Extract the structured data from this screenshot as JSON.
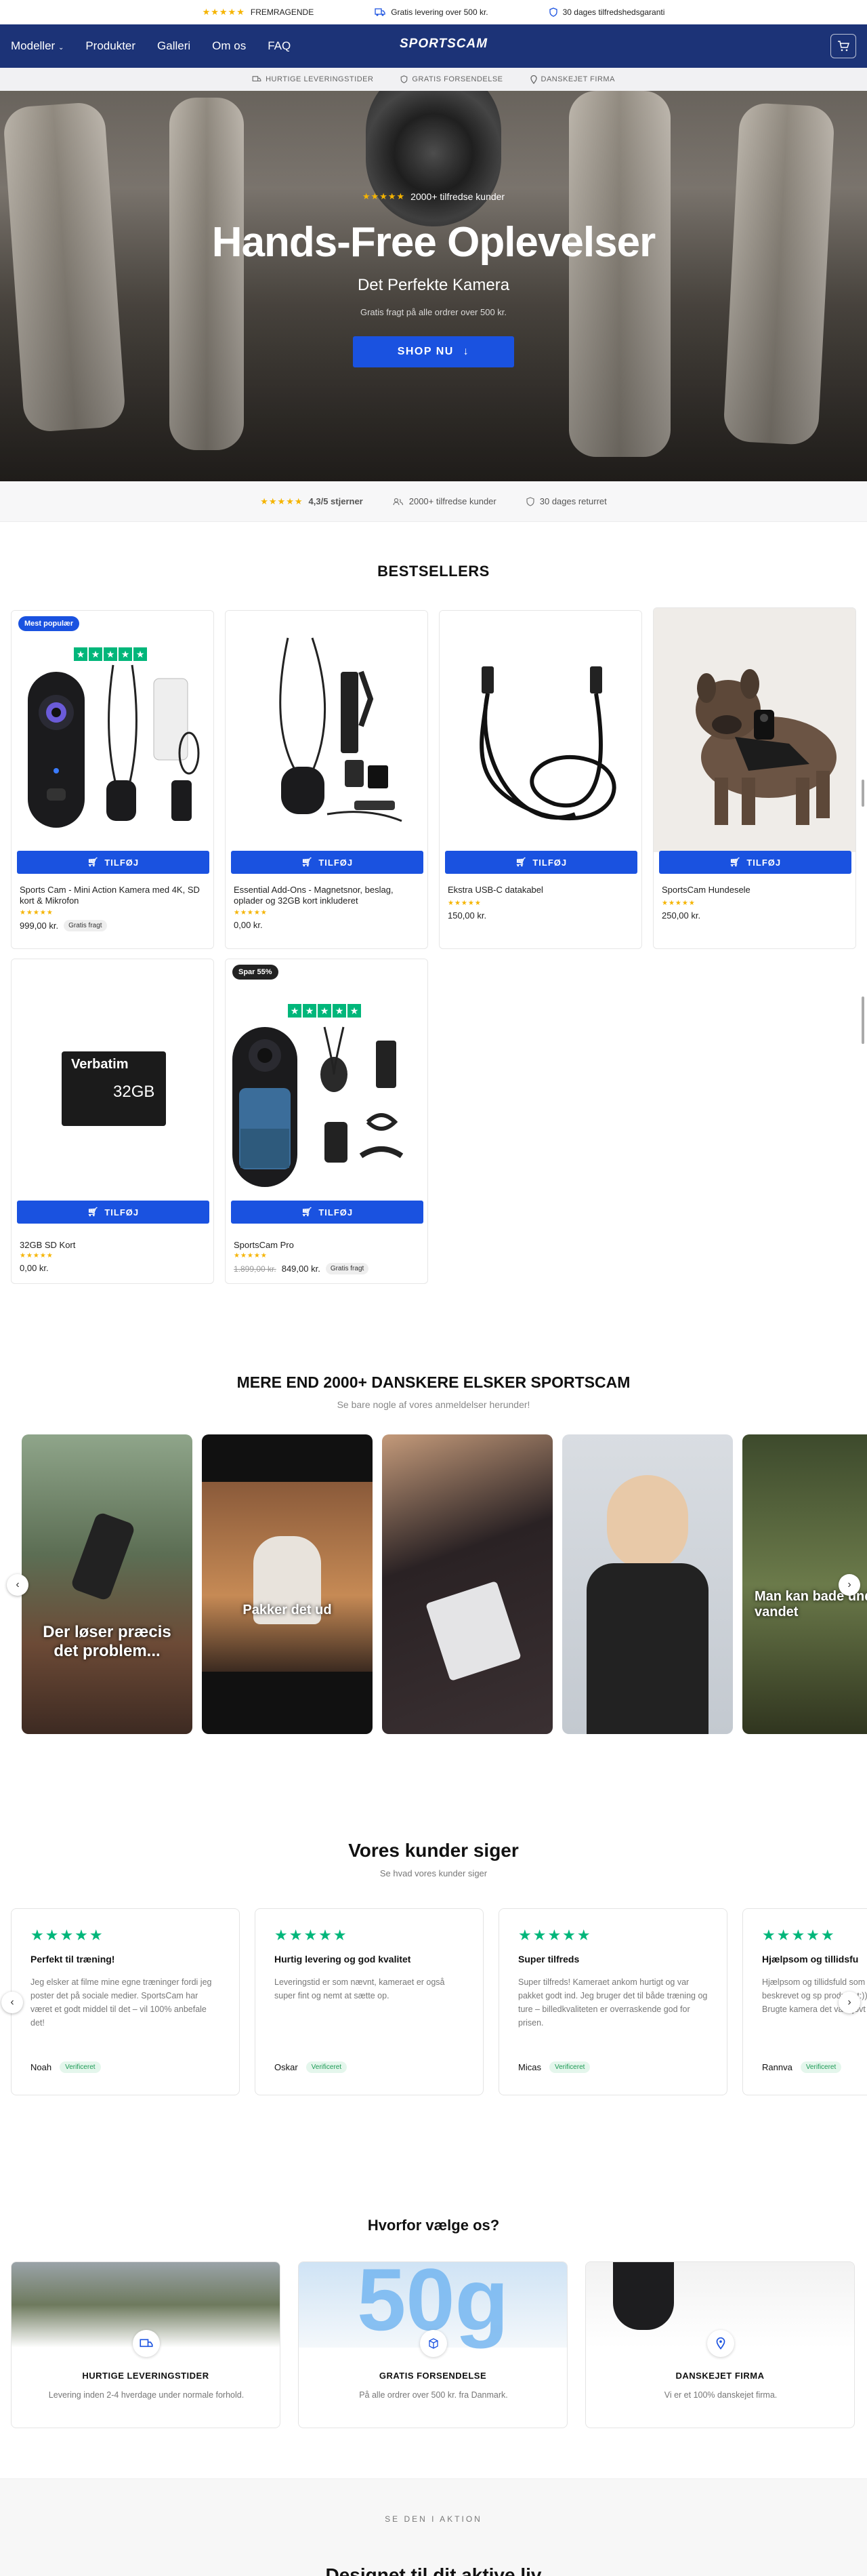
{
  "topbar": {
    "items": [
      {
        "stars": "★★★★★",
        "label": "FREMRAGENDE"
      },
      {
        "icon": "truck-icon",
        "label": "Gratis levering over 500 kr."
      },
      {
        "icon": "shield-icon",
        "label": "30 dages tilfredshedsgaranti"
      }
    ]
  },
  "nav": {
    "links": [
      "Modeller",
      "Produkter",
      "Galleri",
      "Om os",
      "FAQ"
    ],
    "logo": "SPORTSCAM"
  },
  "subbar": {
    "items": [
      "HURTIGE LEVERINGSTIDER",
      "GRATIS FORSENDELSE",
      "DANSKEJET FIRMA"
    ]
  },
  "hero": {
    "stars": "★★★★★",
    "rating_text": "2000+ tilfredse kunder",
    "title": "Hands-Free Oplevelser",
    "subtitle": "Det Perfekte Kamera",
    "small": "Gratis fragt på alle ordrer over 500 kr.",
    "cta": "SHOP NU"
  },
  "trust": {
    "stars": "★★★★★",
    "rating": "4,3/5 stjerner",
    "customers": "2000+ tilfredse kunder",
    "returns": "30 dages returret"
  },
  "bestsellers": {
    "heading": "BESTSELLERS",
    "add_label": "TILFØJ",
    "free_label": "Gratis fragt",
    "products": [
      {
        "badge": "Mest populær",
        "title": "Sports Cam - Mini Action Kamera med 4K, SD kort & Mikrofon",
        "stars": "★★★★★",
        "price": "999,00 kr.",
        "free": true
      },
      {
        "badge": "",
        "title": "Essential Add-Ons - Magnetsnor, beslag, oplader og 32GB kort inkluderet",
        "stars": "★★★★★",
        "price": "0,00 kr.",
        "free": false
      },
      {
        "badge": "",
        "title": "Ekstra USB-C datakabel",
        "stars": "★★★★★",
        "price": "150,00 kr.",
        "free": false
      },
      {
        "badge": "",
        "title": "SportsCam Hundesele",
        "stars": "★★★★★",
        "price": "250,00 kr.",
        "free": false
      },
      {
        "badge": "",
        "title": "32GB SD Kort",
        "stars": "★★★★★",
        "price": "0,00 kr.",
        "free": false
      },
      {
        "badge": "Spar 55%",
        "title": "SportsCam Pro",
        "stars": "★★★★★",
        "old_price": "1.899,00 kr.",
        "price": "849,00 kr.",
        "free": true
      }
    ],
    "sd_brand": "Verbatim",
    "sd_size": "32GB"
  },
  "ugc": {
    "heading": "MERE END 2000+ DANSKERE ELSKER SPORTSCAM",
    "sub": "Se bare nogle af vores anmeldelser herunder!",
    "captions": [
      "Der løser præcis det problem...",
      "Pakker det ud",
      "",
      "",
      "Man kan bade under vandet"
    ]
  },
  "reviews": {
    "heading": "Vores kunder siger",
    "sub": "Se hvad vores kunder siger",
    "verified": "Verificeret",
    "items": [
      {
        "title": "Perfekt til træning!",
        "body": "Jeg elsker at filme mine egne træninger fordi jeg poster det på sociale medier. SportsCam har været et godt middel til det – vil 100% anbefale det!",
        "name": "Noah"
      },
      {
        "title": "Hurtig levering og god kvalitet",
        "body": "Leveringstid er som nævnt, kameraet er også super fint og nemt at sætte op.",
        "name": "Oskar"
      },
      {
        "title": "Super tilfreds",
        "body": "Super tilfreds! Kameraet ankom hurtigt og var pakket godt ind. Jeg bruger det til både træning og ture – billedkvaliteten er overraskende god for prisen.",
        "name": "Micas"
      },
      {
        "title": "Hjælpsom og tillidsfu",
        "body": "Hjælpsom og tillidsfuld som beskrevet og sp produktet:)) Brugte kamera det var sjovt a",
        "name": "Rannva"
      }
    ]
  },
  "why": {
    "heading": "Hvorfor vælge os?",
    "items": [
      {
        "icon": "truck-icon",
        "title": "HURTIGE LEVERINGSTIDER",
        "desc": "Levering inden 2-4 hverdage under normale forhold."
      },
      {
        "icon": "box-icon",
        "title": "GRATIS FORSENDELSE",
        "desc": "På alle ordrer over 500 kr. fra Danmark."
      },
      {
        "icon": "pin-icon",
        "title": "DANSKEJET FIRMA",
        "desc": "Vi er et 100% danskejet firma."
      }
    ],
    "big_text": "50g"
  },
  "action": {
    "kicker": "SE DEN I AKTION",
    "title": "Designet til dit aktive liv"
  },
  "colors": {
    "nav": "#1c3377",
    "primary": "#1a52e0",
    "trustpilot": "#00b67a",
    "star": "#f5b400"
  }
}
